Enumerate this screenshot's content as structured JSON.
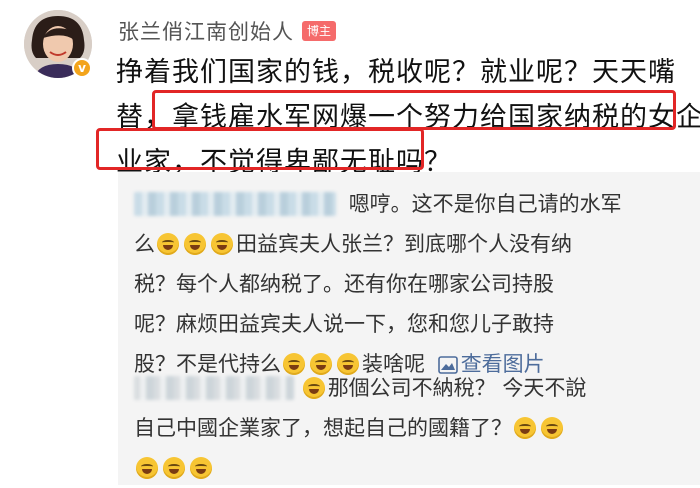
{
  "post": {
    "username": "张兰俏江南创始人",
    "author_badge": "博主",
    "verified_mark": "v",
    "lines": [
      "挣着我们国家的钱，税收呢？就业呢？天天嘴",
      "替，拿钱雇水军网爆一个努力给国家纳税的女企",
      "业家，不觉得卑鄙无耻吗？"
    ]
  },
  "colors": {
    "highlight": "#e22626",
    "author_badge": "#f56b6b",
    "verified": "#f3a41b",
    "link": "#4d6c9b",
    "reply_bg": "#f4f4f4"
  },
  "replies": [
    {
      "lines": [
        "嗯哼。这不是你自己请的水军",
        "田益宾夫人张兰？到底哪个人没有纳",
        "税？每个人都纳税了。还有你在哪家公司持股",
        "呢？麻烦田益宾夫人说一下，您和您儿子敢持",
        "股？不是代持么",
        "装啥呢"
      ],
      "line2_prefix": "么",
      "view_image": "查看图片"
    },
    {
      "lines": [
        "那個公司不納稅？ 今天不說",
        "自己中國企業家了，想起自己的國籍了？"
      ]
    }
  ],
  "icons": [
    "avatar",
    "verified-badge-icon",
    "laughing-tears-emoji-icon",
    "image-icon"
  ]
}
